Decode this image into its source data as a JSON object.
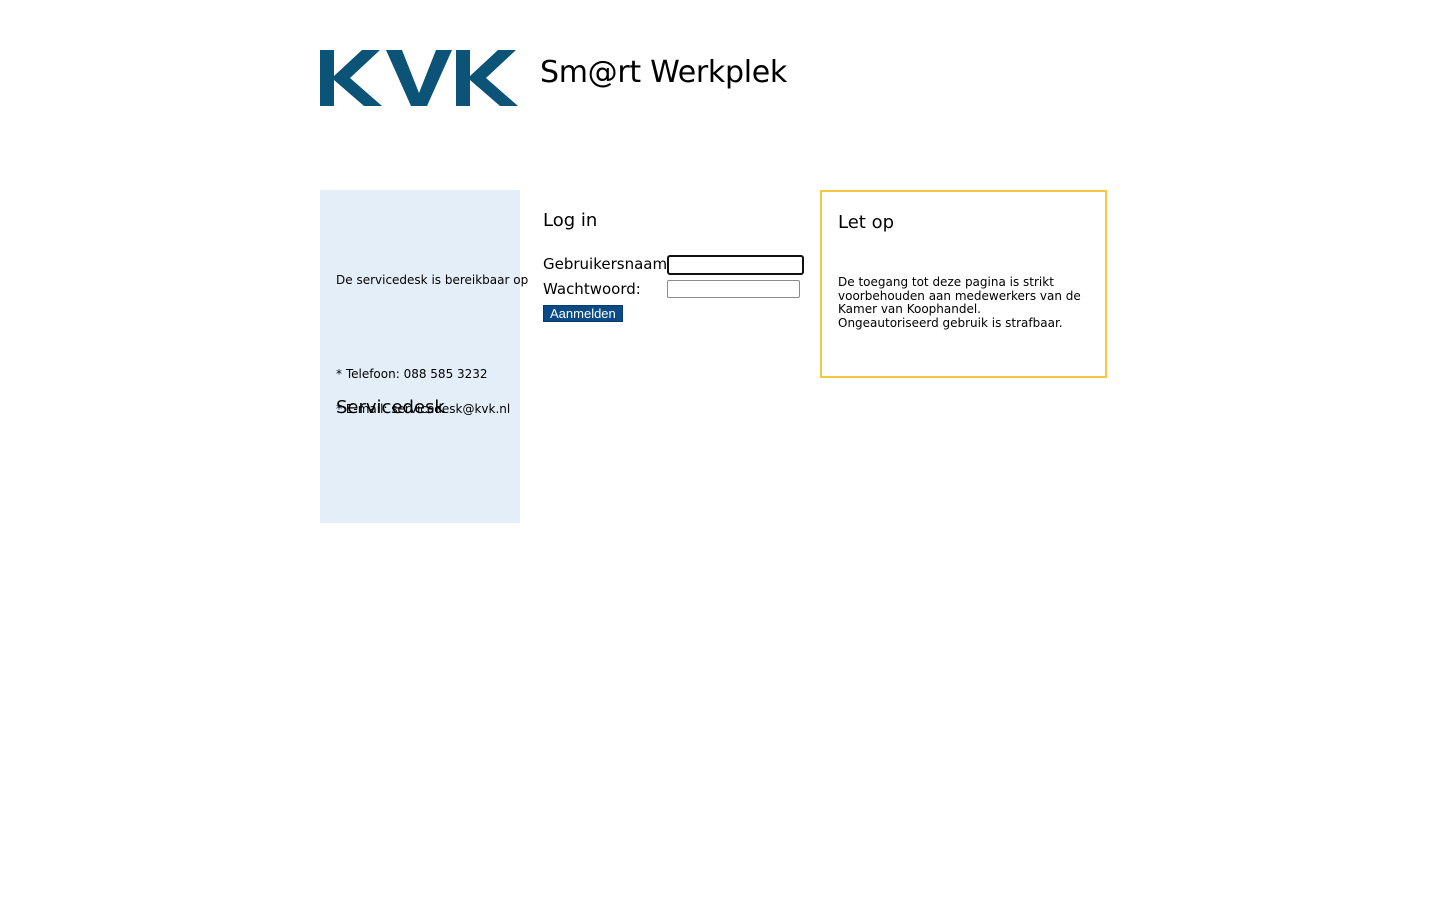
{
  "header": {
    "logo_text": "KVK",
    "app_title": "Sm@rt Werkplek",
    "brand_color": "#0b5478"
  },
  "servicedesk": {
    "title": "Servicedesk",
    "description": "De servicedesk is bereikbaar op",
    "phone": "* Telefoon: 088 585 3232",
    "email": "* E-mail: servicedesk@kvk.nl",
    "background_color": "#e4eef8"
  },
  "login": {
    "title": "Log in",
    "username_label": "Gebruikersnaam:",
    "username_value": "",
    "password_label": "Wachtwoord:",
    "password_value": "",
    "submit_label": "Aanmelden",
    "button_color": "#0a4a86"
  },
  "notice": {
    "title": "Let op",
    "text_lines": [
      "De toegang tot deze pagina is strikt",
      "voorbehouden aan medewerkers van de",
      "Kamer van Koophandel.",
      "Ongeautoriseerd gebruik is strafbaar."
    ],
    "border_color": "#f5c842"
  }
}
